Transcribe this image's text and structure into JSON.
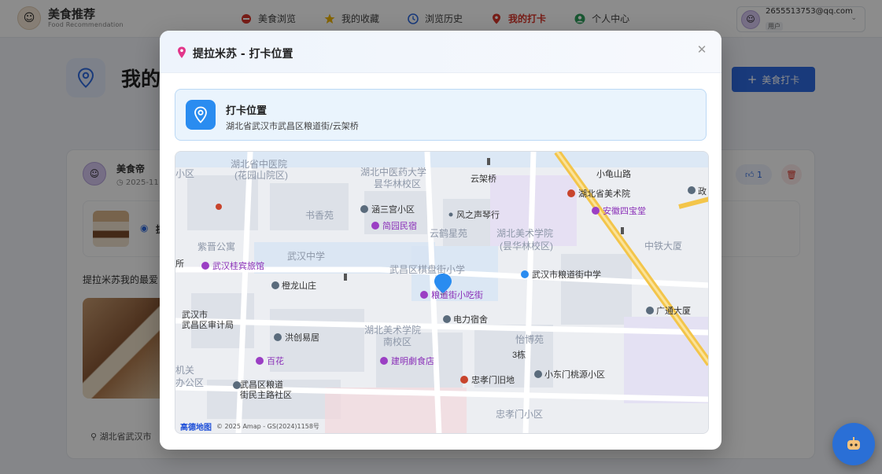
{
  "app": {
    "title": "美食推荐",
    "subtitle": "Food Recommendation"
  },
  "nav": {
    "items": [
      {
        "label": "美食浏览",
        "icon": "food-icon"
      },
      {
        "label": "我的收藏",
        "icon": "star-icon"
      },
      {
        "label": "浏览历史",
        "icon": "clock-icon"
      },
      {
        "label": "我的打卡",
        "icon": "location-pin-icon",
        "active": true
      },
      {
        "label": "个人中心",
        "icon": "user-icon"
      }
    ]
  },
  "user": {
    "email": "2655513753@qq.com",
    "role": "用户"
  },
  "page": {
    "title": "我的",
    "add_button": "美食打卡"
  },
  "checkin_card": {
    "username": "美食帝",
    "date": "2025-11",
    "likes": "1",
    "food_name": "提",
    "description": "提拉米苏我的最爱",
    "location": "湖北省武汉市"
  },
  "modal": {
    "title": "提拉米苏 - 打卡位置",
    "location_label": "打卡位置",
    "location_address": "湖北省武汉市武昌区粮道街/云架桥"
  },
  "map": {
    "provider_logo": "高德地图",
    "attribution": "© 2025 Amap - GS(2024)1158号",
    "labels": {
      "l1": "湖北省中医院",
      "l1b": "(花园山院区)",
      "l2": "湖北中医药大学",
      "l2b": "昙华林校区",
      "l3": "云架桥",
      "l4": "小龟山路",
      "l5": "湖北省美术院",
      "l6": "安徽四宝堂",
      "l7": "涵三宫小区",
      "l8": "风之声琴行",
      "l9": "书香苑",
      "l10": "简园民宿",
      "l11": "云鹤星苑",
      "l12": "湖北美术学院",
      "l12b": "(昙华林校区)",
      "l13": "中铁大厦",
      "l14": "紫晋公寓",
      "l15": "武汉中学",
      "l16": "武汉桂宾旅馆",
      "l17": "武昌区棋盘街小学",
      "l18": "武汉市粮道街中学",
      "l19": "橙龙山庄",
      "l20": "粮道街小吃街",
      "l21": "武汉市",
      "l21b": "武昌区审计局",
      "l22": "电力宿舍",
      "l23": "广通大厦",
      "l24": "洪创易居",
      "l25": "湖北美术学院",
      "l25b": "南校区",
      "l26": "怡博苑",
      "l27": "百花",
      "l28": "建明劇食店",
      "l29": "3栋",
      "l30": "小东门桃源小区",
      "l31": "武昌区粮道",
      "l31b": "街民主路社区",
      "l32": "忠孝门旧地",
      "l33": "忠孝门小区",
      "l34": "小区",
      "l35": "政",
      "l36": "所",
      "l37": "机关",
      "l37b": "办公区"
    }
  },
  "colors": {
    "accent": "#2f6be0",
    "active_nav": "#d9362b",
    "poi_purple": "#9b3fc4",
    "poi_red": "#c8442c",
    "poi_gray": "#5a6b7c",
    "road_yellow": "#f3c54a"
  }
}
